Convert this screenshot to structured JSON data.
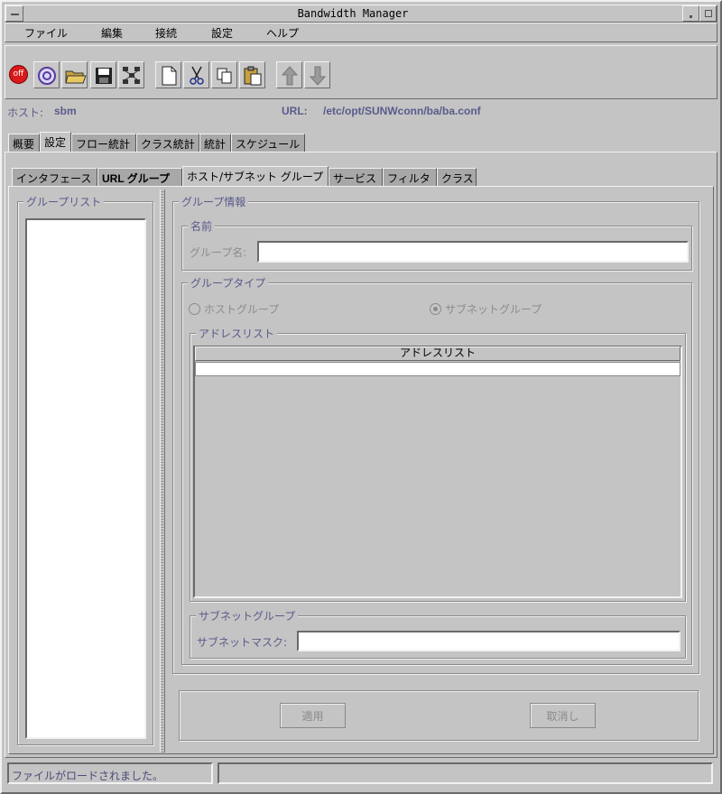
{
  "window": {
    "title": "Bandwidth Manager"
  },
  "menubar": {
    "items": [
      "ファイル",
      "編集",
      "接続",
      "設定",
      "ヘルプ"
    ]
  },
  "toolbar": {
    "icons": [
      "off-icon",
      "connect-icon",
      "open-folder-icon",
      "save-icon",
      "network-icon",
      "new-file-icon",
      "cut-icon",
      "copy-icon",
      "paste-icon",
      "up-arrow-icon",
      "down-arrow-icon"
    ],
    "off_label": "off"
  },
  "info": {
    "host_label": "ホスト:",
    "host_value": "sbm",
    "url_label": "URL:",
    "url_value": "/etc/opt/SUNWconn/ba/ba.conf"
  },
  "main_tabs": [
    "概要",
    "設定",
    "フロー統計",
    "クラス統計",
    "統計",
    "スケジュール"
  ],
  "sub_tabs": [
    "インタフェース",
    "URL グループ",
    "ホスト/サブネット グループ",
    "サービス",
    "フィルタ",
    "クラス"
  ],
  "group_list": {
    "title": "グループリスト"
  },
  "group_info": {
    "title": "グループ情報",
    "name_section": "名前",
    "group_name_label": "グループ名:",
    "group_name_value": "",
    "type_section": "グループタイプ",
    "host_group": "ホストグループ",
    "subnet_group": "サブネットグループ",
    "address_list_section": "アドレスリスト",
    "address_list_header": "アドレスリスト",
    "subnet_section": "サブネットグループ",
    "subnet_mask_label": "サブネットマスク:",
    "subnet_mask_value": ""
  },
  "buttons": {
    "apply": "適用",
    "cancel": "取消し"
  },
  "status": {
    "message": "ファイルがロードされました。"
  },
  "colors": {
    "background": "#c4c4c4",
    "label_blue": "#5a5a8c",
    "off_red": "#d81a1a"
  }
}
